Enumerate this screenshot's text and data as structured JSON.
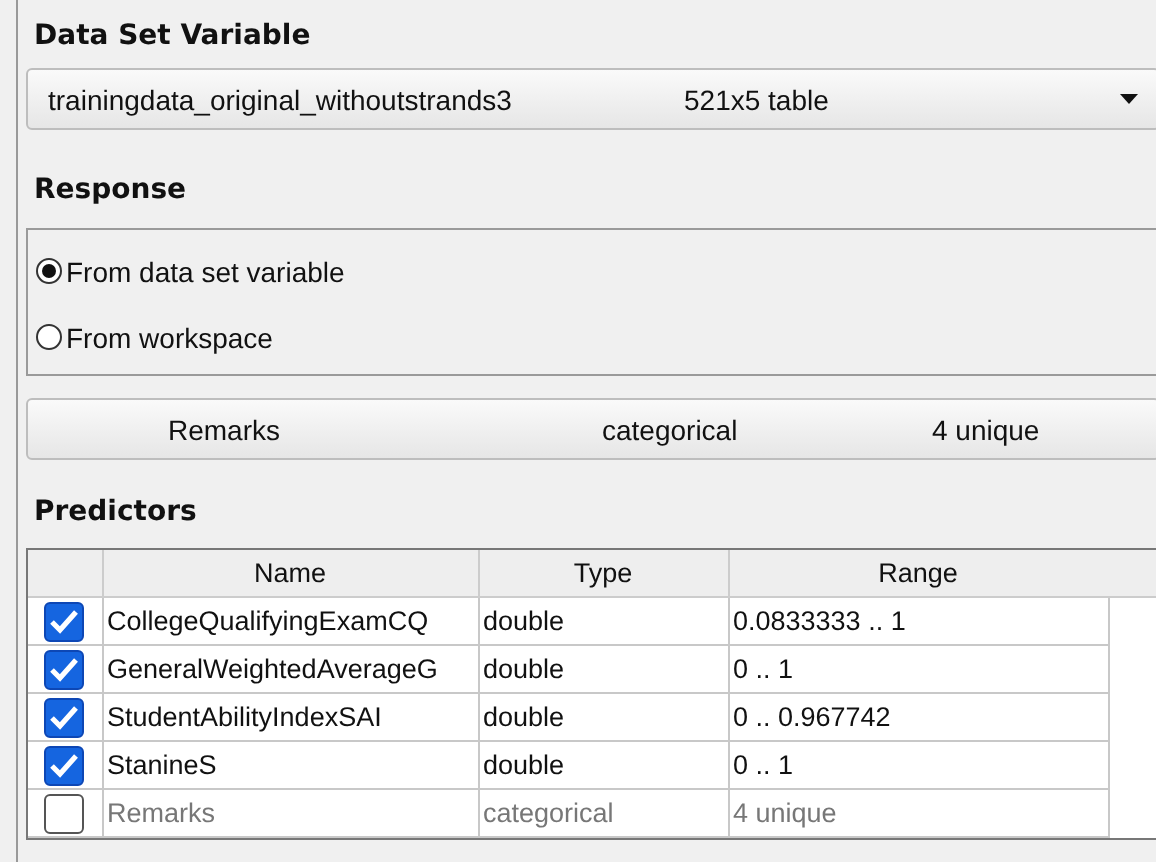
{
  "data_set_variable": {
    "heading": "Data Set Variable",
    "dropdown": {
      "name": "trainingdata_original_withoutstrands3",
      "description": "521x5 table"
    }
  },
  "response": {
    "heading": "Response",
    "options": [
      {
        "label": "From data set variable",
        "selected": true
      },
      {
        "label": "From workspace",
        "selected": false
      }
    ],
    "dropdown": {
      "name": "Remarks",
      "type": "categorical",
      "range": "4 unique"
    }
  },
  "predictors": {
    "heading": "Predictors",
    "columns": [
      "Name",
      "Type",
      "Range"
    ],
    "rows": [
      {
        "checked": true,
        "disabled": false,
        "name": "CollegeQualifyingExamCQ",
        "type": "double",
        "range": "0.0833333 .. 1"
      },
      {
        "checked": true,
        "disabled": false,
        "name": "GeneralWeightedAverageG",
        "type": "double",
        "range": "0 .. 1"
      },
      {
        "checked": true,
        "disabled": false,
        "name": "StudentAbilityIndexSAI",
        "type": "double",
        "range": "0 .. 0.967742"
      },
      {
        "checked": true,
        "disabled": false,
        "name": "StanineS",
        "type": "double",
        "range": "0 .. 1"
      },
      {
        "checked": false,
        "disabled": true,
        "name": "Remarks",
        "type": "categorical",
        "range": "4 unique"
      }
    ]
  }
}
